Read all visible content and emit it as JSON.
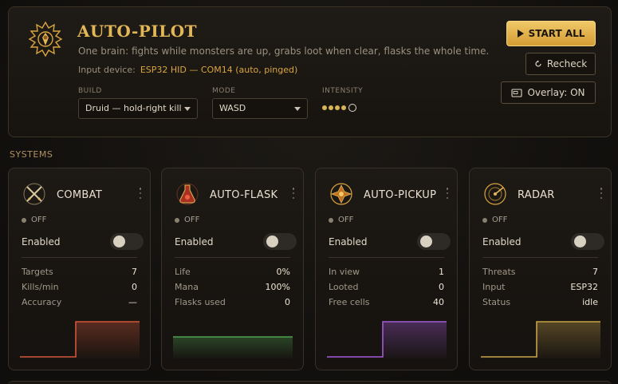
{
  "header": {
    "title": "AUTO-PILOT",
    "subtitle": "One brain: fights while monsters are up, grabs loot when clear, flasks the whole time.",
    "device_label": "Input device:",
    "device_value": "ESP32 HID — COM14 (auto, pinged)",
    "logo_icon": "crest-emblem-icon",
    "accent_color": "#e3b758"
  },
  "controls": {
    "build_label": "BUILD",
    "build_value": "Druid — hold-right kill",
    "mode_label": "MODE",
    "mode_value": "WASD",
    "intensity_label": "INTENSITY",
    "intensity_level": 4,
    "intensity_max": 5
  },
  "actions": {
    "start_all": "START ALL",
    "recheck": "Recheck",
    "overlay": "Overlay: ON"
  },
  "systems_title": "SYSTEMS",
  "cards": [
    {
      "title": "COMBAT",
      "icon": "crossed-swords-icon",
      "status": "OFF",
      "enabled_label": "Enabled",
      "enabled": false,
      "color": "#d2573a",
      "stats": [
        {
          "label": "Targets",
          "value": "7"
        },
        {
          "label": "Kills/min",
          "value": "0"
        },
        {
          "label": "Accuracy",
          "value": "—"
        }
      ],
      "spark": [
        0,
        0,
        0,
        0,
        0,
        0,
        0,
        1,
        1,
        1,
        1,
        1,
        1,
        1,
        1,
        1
      ]
    },
    {
      "title": "AUTO-FLASK",
      "icon": "flask-icon",
      "status": "OFF",
      "enabled_label": "Enabled",
      "enabled": false,
      "color": "#4fa04f",
      "stats": [
        {
          "label": "Life",
          "value": "0%"
        },
        {
          "label": "Mana",
          "value": "100%"
        },
        {
          "label": "Flasks used",
          "value": "0"
        }
      ],
      "spark": [
        0,
        0,
        0,
        0,
        0,
        0,
        0,
        0,
        0,
        0,
        0,
        0,
        0,
        0,
        0,
        0
      ]
    },
    {
      "title": "AUTO-PICKUP",
      "icon": "loot-pickup-icon",
      "status": "OFF",
      "enabled_label": "Enabled",
      "enabled": false,
      "color": "#a45ad8",
      "stats": [
        {
          "label": "In view",
          "value": "1"
        },
        {
          "label": "Looted",
          "value": "0"
        },
        {
          "label": "Free cells",
          "value": "40"
        }
      ],
      "spark": [
        0,
        0,
        0,
        0,
        0,
        0,
        0,
        1,
        1,
        1,
        1,
        1,
        1,
        1,
        1,
        1
      ]
    },
    {
      "title": "RADAR",
      "icon": "radar-icon",
      "status": "OFF",
      "enabled_label": "Enabled",
      "enabled": false,
      "color": "#c8a24a",
      "stats": [
        {
          "label": "Threats",
          "value": "7"
        },
        {
          "label": "Input",
          "value": "ESP32"
        },
        {
          "label": "Status",
          "value": "idle"
        }
      ],
      "spark": [
        0,
        0,
        0,
        0,
        0,
        0,
        0,
        1,
        1,
        1,
        1,
        1,
        1,
        1,
        1,
        1
      ]
    }
  ]
}
